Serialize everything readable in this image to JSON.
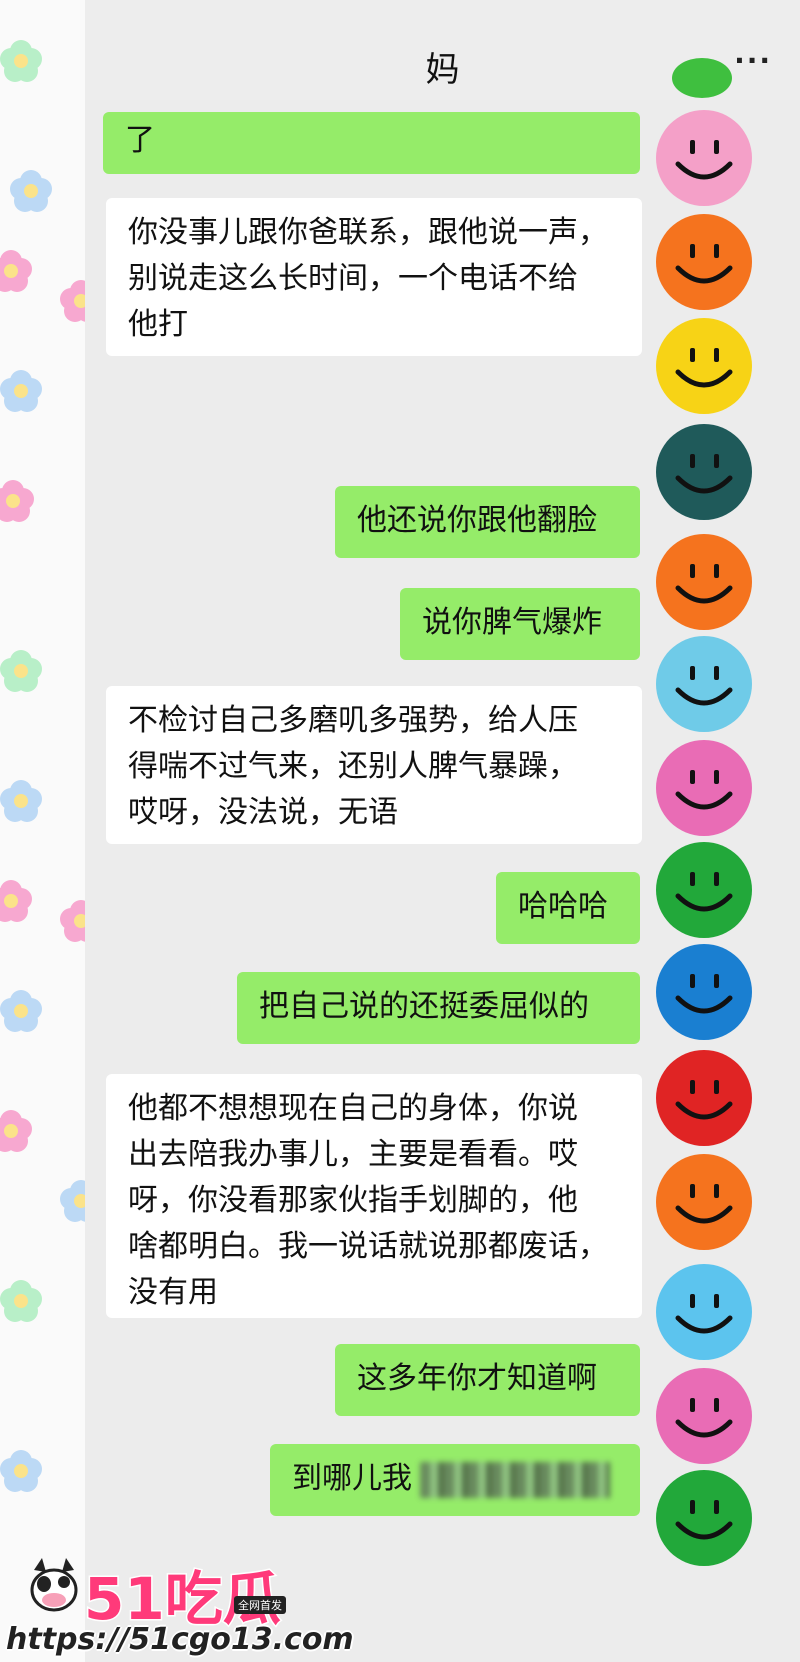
{
  "header": {
    "title": "妈",
    "more_label": "···"
  },
  "messages": [
    {
      "side": "out",
      "lines": [
        "了"
      ]
    },
    {
      "side": "in",
      "lines": [
        "你没事儿跟你爸联系，跟他说一声，",
        "别说走这么长时间，一个电话不给",
        "他打"
      ]
    },
    {
      "side": "out",
      "lines": [
        "他还说你跟他翻脸"
      ]
    },
    {
      "side": "out",
      "lines": [
        "说你脾气爆炸"
      ]
    },
    {
      "side": "in",
      "lines": [
        "不检讨自己多磨叽多强势，给人压",
        "得喘不过气来，还别人脾气暴躁，",
        "哎呀，没法说，无语"
      ]
    },
    {
      "side": "out",
      "lines": [
        "哈哈哈"
      ]
    },
    {
      "side": "out",
      "lines": [
        "把自己说的还挺委屈似的"
      ]
    },
    {
      "side": "in",
      "lines": [
        "他都不想想现在自己的身体，你说",
        "出去陪我办事儿，主要是看看。哎",
        "呀，你没看那家伙指手划脚的，他",
        "啥都明白。我一说话就说那都废话，",
        "没有用"
      ]
    },
    {
      "side": "out",
      "lines": [
        "这多年你才知道啊"
      ]
    },
    {
      "side": "out",
      "lines": [
        "到哪儿我"
      ]
    }
  ],
  "watermark": {
    "logo_text": "51吃瓜",
    "tag_text": "全网首发",
    "url_text": "https://51cgo13.com"
  },
  "colors": {
    "outgoing_bubble": "#95ec69",
    "incoming_bubble": "#ffffff",
    "chat_background": "#ececec",
    "smileys": [
      "#3fbf3f",
      "#f4a0c8",
      "#f5731e",
      "#f7d316",
      "#1f5a5a",
      "#f5731e",
      "#6fcbe8",
      "#e96cb5",
      "#22a83a",
      "#1a7fd1",
      "#e02424",
      "#f5731e",
      "#5cc4ee",
      "#e96cb5",
      "#22a83a"
    ]
  }
}
